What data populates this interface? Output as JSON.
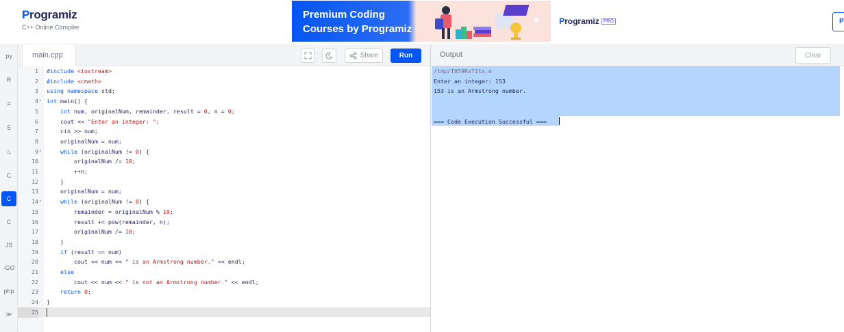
{
  "header": {
    "logo_text": "rogramiz",
    "logo_letter": "P",
    "subtitle": "C++ Online Compiler",
    "banner_line1": "Premium Coding",
    "banner_line2": "Courses by Programiz",
    "pro_logo_letter": "P",
    "pro_logo_text": "rogramiz",
    "pro_badge": "PRO",
    "edge_button": "P"
  },
  "sidebar": {
    "items": [
      {
        "icon": "python-icon",
        "label": "py"
      },
      {
        "icon": "r-icon",
        "label": "R"
      },
      {
        "icon": "sql-icon",
        "label": "≡"
      },
      {
        "icon": "html-icon",
        "label": "5"
      },
      {
        "icon": "java-icon",
        "label": "♨"
      },
      {
        "icon": "c-icon",
        "label": "C"
      },
      {
        "icon": "cpp-icon",
        "label": "C"
      },
      {
        "icon": "csharp-icon",
        "label": "C"
      },
      {
        "icon": "js-icon",
        "label": "JS"
      },
      {
        "icon": "go-icon",
        "label": "-GO"
      },
      {
        "icon": "php-icon",
        "label": "php"
      },
      {
        "icon": "swift-icon",
        "label": "≫"
      }
    ],
    "active_index": 6
  },
  "editor": {
    "file_name": "main.cpp",
    "share_label": "Share",
    "run_label": "Run",
    "lines": [
      "#include <iostream>",
      "#include <cmath>",
      "using namespace std;",
      "int main() {",
      "    int num, originalNum, remainder, result = 0, n = 0;",
      "    cout << \"Enter an integer: \";",
      "    cin >> num;",
      "    originalNum = num;",
      "    while (originalNum != 0) {",
      "        originalNum /= 10;",
      "        ++n;",
      "    }",
      "    originalNum = num;",
      "    while (originalNum != 0) {",
      "        remainder = originalNum % 10;",
      "        result += pow(remainder, n);",
      "        originalNum /= 10;",
      "    }",
      "    if (result == num)",
      "        cout << num << \" is an Armstrong number.\" << endl;",
      "    else",
      "        cout << num << \" is not an Armstrong number.\" << endl;",
      "    return 0;",
      "}",
      ""
    ],
    "fold_lines": [
      4,
      9,
      14
    ],
    "current_line": 25
  },
  "output": {
    "label": "Output",
    "clear_label": "Clear",
    "lines": [
      "/tmp/T859RxT1tx.o",
      "Enter an integer: 153",
      "153 is an Armstrong number.",
      "",
      "",
      "=== Code Execution Successful ==="
    ]
  },
  "colors": {
    "accent": "#0556f3",
    "selection": "#b4d5fe",
    "text_dark": "#25265e"
  }
}
